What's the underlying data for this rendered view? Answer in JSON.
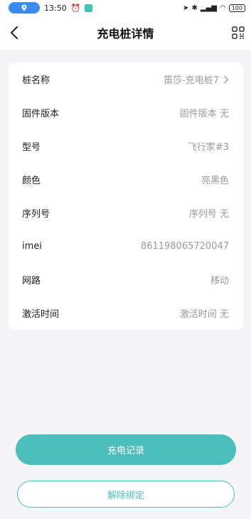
{
  "status_bar": {
    "time": "13:50",
    "battery": "100"
  },
  "header": {
    "title": "充电桩详情"
  },
  "details": [
    {
      "label": "桩名称",
      "value": "笛莎-充电桩7"
    },
    {
      "label": "固件版本",
      "value": "固件版本 无"
    },
    {
      "label": "型号",
      "value": "飞行家#3"
    },
    {
      "label": "颜色",
      "value": "亮黑色"
    },
    {
      "label": "序列号",
      "value": "序列号 无"
    },
    {
      "label": "imei",
      "value": "861198065720047"
    },
    {
      "label": "网路",
      "value": "移动"
    },
    {
      "label": "激活时间",
      "value": "激活时间 无"
    }
  ],
  "actions": {
    "charge_records": "充电记录",
    "unbind": "解除绑定"
  },
  "colors": {
    "accent": "#4cbfbc",
    "status_pill": "#3b8cf0"
  }
}
